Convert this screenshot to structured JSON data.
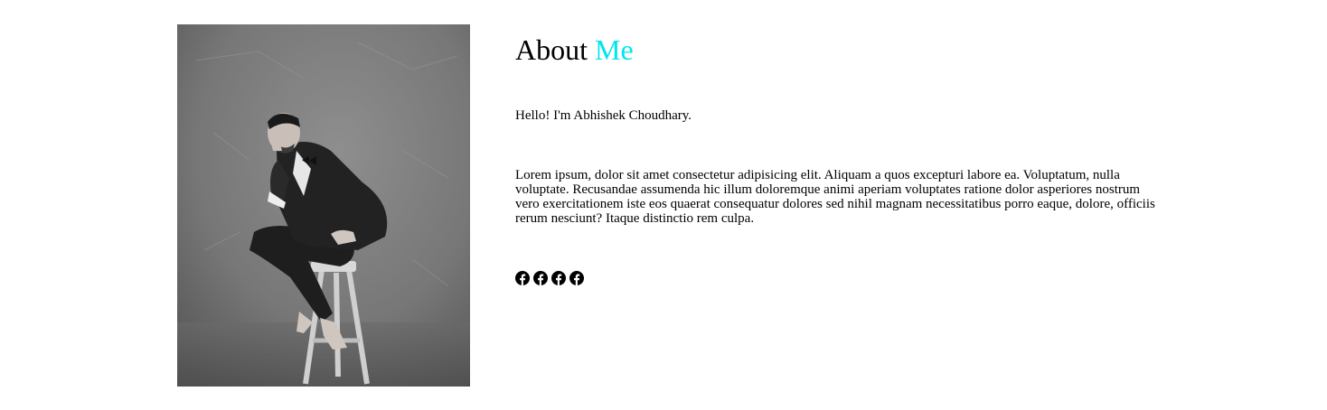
{
  "about": {
    "title_main": "About",
    "title_accent": "Me",
    "greeting": "Hello! I'm Abhishek Choudhary.",
    "bio": "Lorem ipsum, dolor sit amet consectetur adipisicing elit. Aliquam a quos excepturi labore ea. Voluptatum, nulla voluptate. Recusandae assumenda hic illum doloremque animi aperiam voluptates ratione dolor asperiores nostrum vero exercitationem iste eos quaerat consequatur dolores sed nihil magnam necessitatibus porro eaque, dolore, officiis rerum nesciunt? Itaque distinctio rem culpa.",
    "accent_color": "#00e5f0"
  },
  "photo": {
    "style": "black-and-white",
    "subject": "man in suit seated on wooden stool"
  },
  "socials": [
    {
      "icon": "facebook-icon"
    },
    {
      "icon": "facebook-icon"
    },
    {
      "icon": "facebook-icon"
    },
    {
      "icon": "facebook-icon"
    }
  ]
}
